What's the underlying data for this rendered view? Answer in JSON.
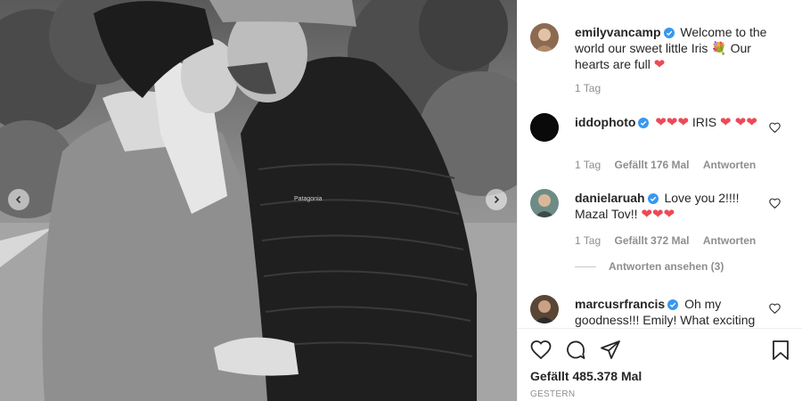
{
  "photo": {
    "jacket_logo": "Patagonia",
    "nav_prev_icon": "chevron-left-icon",
    "nav_next_icon": "chevron-right-icon"
  },
  "caption": {
    "username": "emilyvancamp",
    "text": "Welcome to the world our sweet little Iris",
    "text2": "Our hearts are full",
    "time": "1 Tag"
  },
  "comments": [
    {
      "username": "iddophoto",
      "text": "IRIS",
      "time": "1 Tag",
      "likes": "Gefällt 176 Mal",
      "reply": "Antworten"
    },
    {
      "username": "danielaruah",
      "text": "Love you 2!!!! Mazal Tov!!",
      "time": "1 Tag",
      "likes": "Gefällt 372 Mal",
      "reply": "Antworten",
      "view_replies": "Antworten ansehen (3)"
    },
    {
      "username": "marcusrfrancis",
      "text": "Oh my goodness!!! Emily! What exciting"
    }
  ],
  "footer": {
    "likes": "Gefällt 485.378 Mal",
    "date": "GESTERN"
  },
  "colors": {
    "heart": "#ed4956",
    "verified": "#3897f0",
    "muted": "#8e8e8e"
  }
}
